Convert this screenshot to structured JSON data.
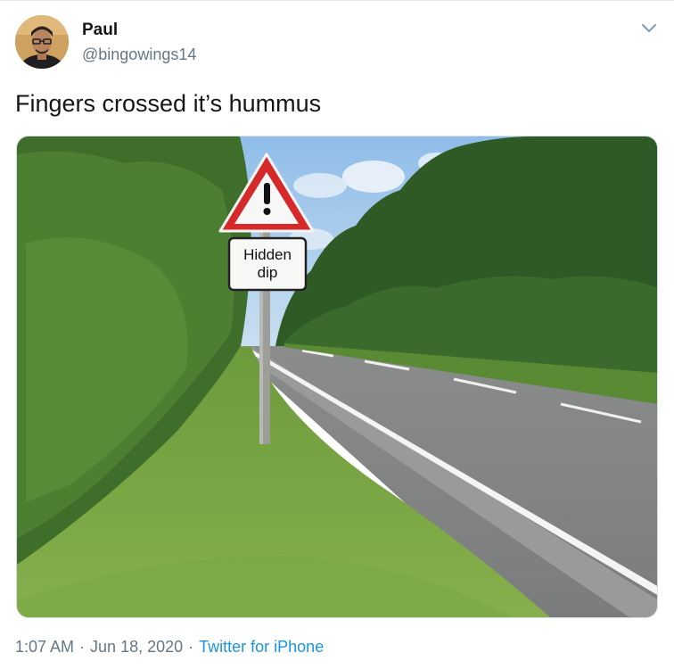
{
  "author": {
    "name": "Paul",
    "handle": "@bingowings14"
  },
  "tweet": {
    "text": "Fingers crossed it’s hummus"
  },
  "media": {
    "sign_text_line1": "Hidden",
    "sign_text_line2": "dip"
  },
  "meta": {
    "time": "1:07 AM",
    "separator": "·",
    "date": "Jun 18, 2020",
    "source": "Twitter for iPhone"
  },
  "icons": {
    "menu": "chevron-down-icon"
  },
  "colors": {
    "link": "#1b95e0",
    "secondary_text": "#657786",
    "primary_text": "#14171a"
  }
}
